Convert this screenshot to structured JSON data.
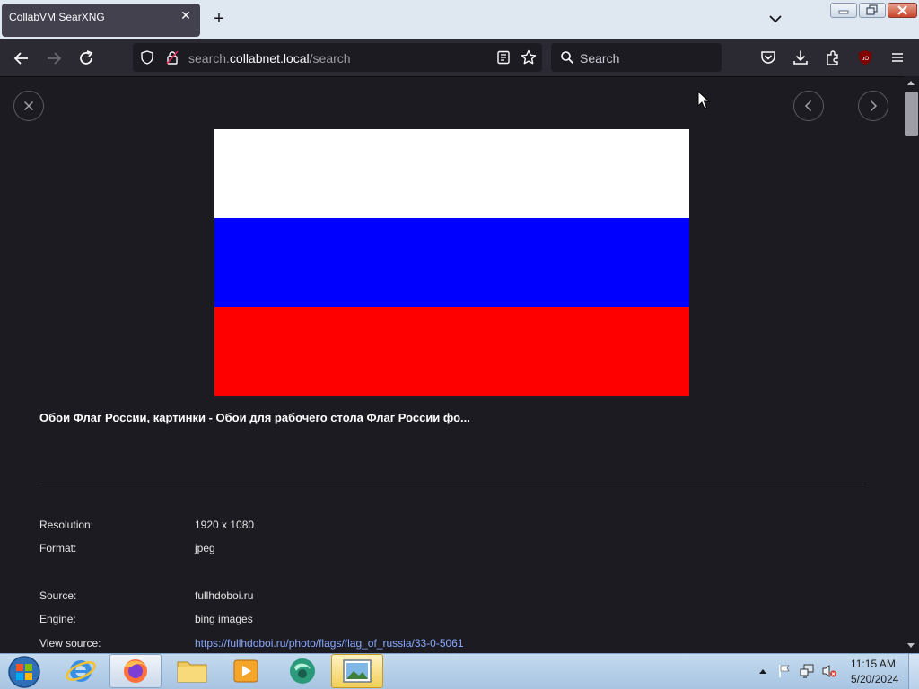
{
  "browser": {
    "tab_title": "CollabVM SearXNG",
    "url_prefix": "search.",
    "url_domain": "collabnet.local",
    "url_path": "/search",
    "search_placeholder": "Search"
  },
  "detail": {
    "image_title": "Обои Флаг России, картинки - Обои для рабочего стола Флаг России фо...",
    "flag_colors": [
      "#ffffff",
      "#0000ff",
      "#ff0000"
    ],
    "fields": [
      {
        "label": "Resolution:",
        "value": "1920 x 1080"
      },
      {
        "label": "Format:",
        "value": "jpeg"
      },
      {
        "label": "Source:",
        "value": "fullhdoboi.ru"
      },
      {
        "label": "Engine:",
        "value": "bing images"
      },
      {
        "label": "View source:",
        "value": "https://fullhdoboi.ru/photo/flags/flag_of_russia/33-0-5061"
      }
    ]
  },
  "taskbar": {
    "apps": [
      "start-orb-icon",
      "internet-explorer-icon",
      "firefox-icon",
      "file-explorer-icon",
      "media-player-icon",
      "collabvm-icon",
      "image-viewer-icon"
    ],
    "time": "11:15 AM",
    "date": "5/20/2024"
  }
}
